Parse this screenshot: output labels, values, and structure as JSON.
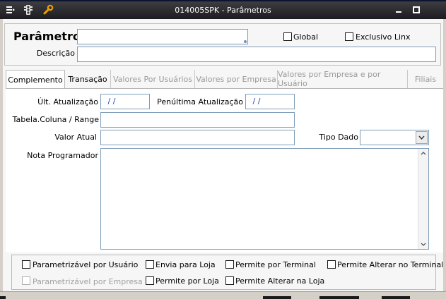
{
  "window": {
    "title": "014005SPK - Parâmetros"
  },
  "header": {
    "parametro_label": "Parâmetro",
    "parametro_value": "",
    "descricao_label": "Descrição",
    "descricao_value": "",
    "global_label": "Global",
    "exclusivo_label": "Exclusivo Linx"
  },
  "tabs": [
    {
      "label": "Complemento",
      "active": true
    },
    {
      "label": "Transação",
      "active": false
    },
    {
      "label": "Valores Por Usuários",
      "active": false
    },
    {
      "label": "Valores por Empresa",
      "active": false
    },
    {
      "label": "Valores por Empresa e por Usuário",
      "active": false
    },
    {
      "label": "Filiais",
      "active": false
    }
  ],
  "form": {
    "ult_atualizacao_label": "Últ. Atualização",
    "ult_atualizacao_value": " / /",
    "penultima_label": "Penúltima Atualização",
    "penultima_value": " / /",
    "tabela_label": "Tabela.Coluna / Range",
    "tabela_value": "",
    "valor_atual_label": "Valor Atual",
    "valor_atual_value": "",
    "tipo_dado_label": "Tipo Dado",
    "tipo_dado_value": "",
    "nota_label": "Nota Programador",
    "nota_value": ""
  },
  "options": {
    "parametrizavel_usuario": "Parametrizável por Usuário",
    "envia_loja": "Envia para Loja",
    "permite_terminal": "Permite por Terminal",
    "permite_alterar_terminal": "Permite Alterar no Terminal",
    "parametrizavel_empresa": "Parametrizável por Empresa",
    "permite_loja": "Permite por Loja",
    "permite_alterar_loja": "Permite Alterar na Loja"
  },
  "icons": {
    "menu": "menu-icon",
    "traffic_light": "traffic-light-icon",
    "wrench": "wrench-icon",
    "minimize": "minimize-icon",
    "maximize": "maximize-icon"
  }
}
